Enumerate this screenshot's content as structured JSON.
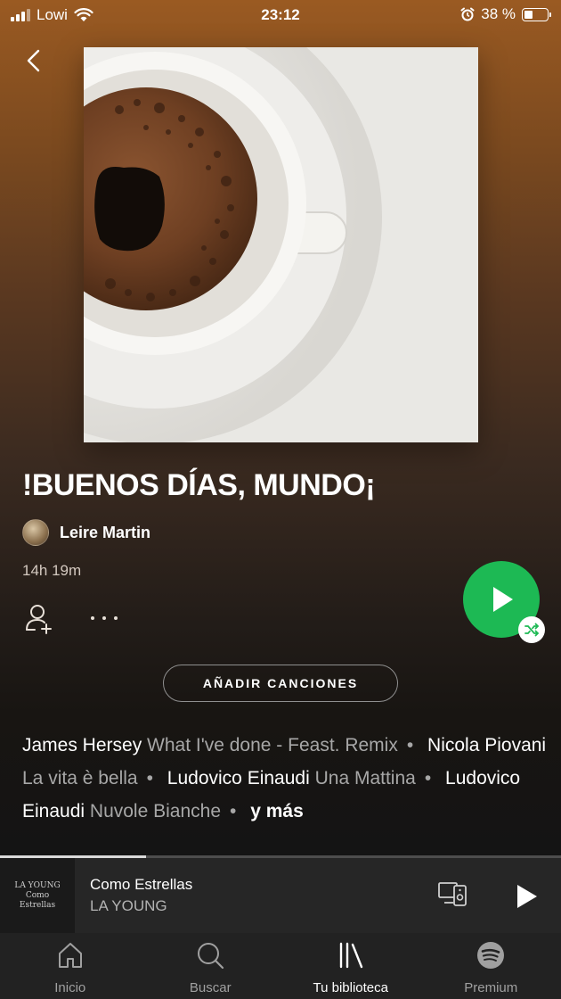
{
  "status_bar": {
    "carrier": "Lowi",
    "time": "23:12",
    "battery": "38 %"
  },
  "playlist": {
    "title": "!BUENOS DÍAS, MUNDO¡",
    "owner": "Leire Martin",
    "duration": "14h 19m",
    "add_songs_label": "AÑADIR CANCIONES"
  },
  "featuring": [
    {
      "artist": "James Hersey",
      "song": "What I've done - Feast. Remix"
    },
    {
      "artist": "Nicola Piovani",
      "song": "La vita è bella"
    },
    {
      "artist": "Ludovico Einaudi",
      "song": "Una Mattina"
    },
    {
      "artist": "Ludovico Einaudi",
      "song": "Nuvole Bianche"
    }
  ],
  "featuring_more": "y más",
  "now_playing": {
    "title": "Como Estrellas",
    "artist": "LA YOUNG",
    "art_text": [
      "LA YOUNG",
      "Como",
      "Estrellas"
    ],
    "progress": 0.26
  },
  "tabs": [
    {
      "label": "Inicio",
      "icon": "home-icon",
      "active": false
    },
    {
      "label": "Buscar",
      "icon": "search-icon",
      "active": false
    },
    {
      "label": "Tu biblioteca",
      "icon": "library-icon",
      "active": true
    },
    {
      "label": "Premium",
      "icon": "spotify-icon",
      "active": false
    }
  ],
  "colors": {
    "accent": "#1db954",
    "header_gradient_top": "#9a5a22",
    "background": "#121212"
  }
}
